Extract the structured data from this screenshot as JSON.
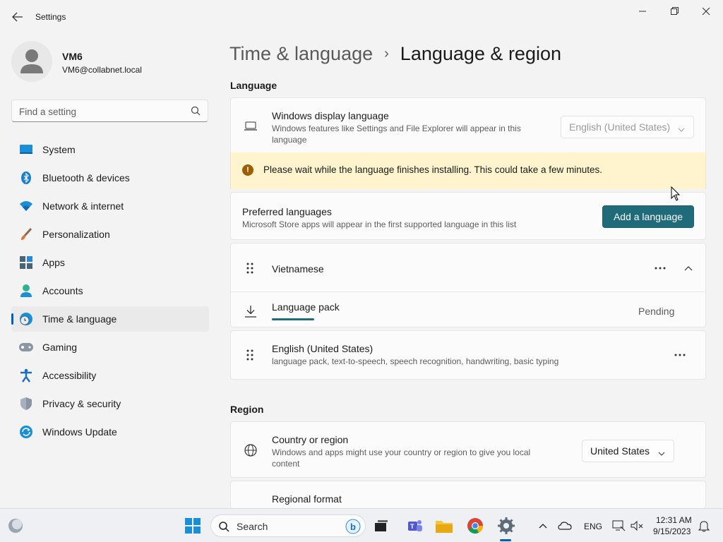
{
  "window": {
    "title": "Settings"
  },
  "profile": {
    "name": "VM6",
    "email": "VM6@collabnet.local"
  },
  "search": {
    "placeholder": "Find a setting"
  },
  "sidebar": {
    "items": [
      {
        "label": "System",
        "icon": "system-icon"
      },
      {
        "label": "Bluetooth & devices",
        "icon": "bluetooth-icon"
      },
      {
        "label": "Network & internet",
        "icon": "wifi-icon"
      },
      {
        "label": "Personalization",
        "icon": "brush-icon"
      },
      {
        "label": "Apps",
        "icon": "apps-icon"
      },
      {
        "label": "Accounts",
        "icon": "accounts-icon"
      },
      {
        "label": "Time & language",
        "icon": "globe-clock-icon",
        "active": true
      },
      {
        "label": "Gaming",
        "icon": "gamepad-icon"
      },
      {
        "label": "Accessibility",
        "icon": "accessibility-icon"
      },
      {
        "label": "Privacy & security",
        "icon": "shield-icon"
      },
      {
        "label": "Windows Update",
        "icon": "update-icon"
      }
    ]
  },
  "breadcrumb": {
    "parent": "Time & language",
    "separator": "›",
    "current": "Language & region"
  },
  "language": {
    "section_title": "Language",
    "display": {
      "title": "Windows display language",
      "subtitle_line1": "Windows features like Settings and File Explorer will appear in this",
      "subtitle_line2": "language",
      "value": "English (United States)"
    },
    "warning": "Please wait while the language finishes installing. This could take a few minutes.",
    "preferred": {
      "title": "Preferred languages",
      "subtitle": "Microsoft Store apps will appear in the first supported language in this list",
      "add_button": "Add a language"
    },
    "vietnamese": {
      "name": "Vietnamese",
      "pack_label": "Language pack",
      "pack_status": "Pending"
    },
    "english": {
      "name": "English (United States)",
      "features": "language pack, text-to-speech, speech recognition, handwriting, basic typing"
    }
  },
  "region": {
    "section_title": "Region",
    "country": {
      "title": "Country or region",
      "subtitle_line1": "Windows and apps might use your country or region to give you local",
      "subtitle_line2": "content",
      "value": "United States"
    },
    "format": {
      "title": "Regional format"
    }
  },
  "taskbar": {
    "search_label": "Search",
    "language": "ENG",
    "time": "12:31 AM",
    "date": "9/15/2023"
  },
  "colors": {
    "accent": "#1f6b7a",
    "warning_bg": "#fff4ce",
    "nav_accent": "#005fb8"
  }
}
